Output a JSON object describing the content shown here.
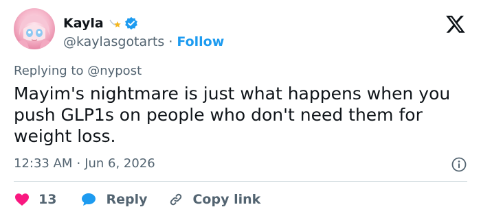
{
  "author": {
    "display_name": "Kayla",
    "handle": "@kaylasgotarts",
    "separator": "·",
    "follow_label": "Follow"
  },
  "tweet": {
    "replying_to": "Replying to @nypost",
    "text": "Mayim's nightmare is just what happens when you push GLP1s on people who don't need them for weight loss.",
    "time": "12:33 AM",
    "date_separator": "·",
    "date": "Jun 6, 2026"
  },
  "actions": {
    "like_count": "13",
    "reply_label": "Reply",
    "copy_link_label": "Copy link"
  },
  "colors": {
    "accent": "#1d9bf0",
    "like": "#f91880",
    "muted_text": "#536471",
    "primary_text": "#0f1419",
    "divider": "#cfd9de"
  },
  "icons": {
    "star": "shooting-star-icon",
    "verified": "verified-badge-icon",
    "brand": "x-logo-icon",
    "info": "info-icon",
    "like": "heart-icon",
    "reply": "speech-bubble-icon",
    "copy": "link-icon"
  }
}
